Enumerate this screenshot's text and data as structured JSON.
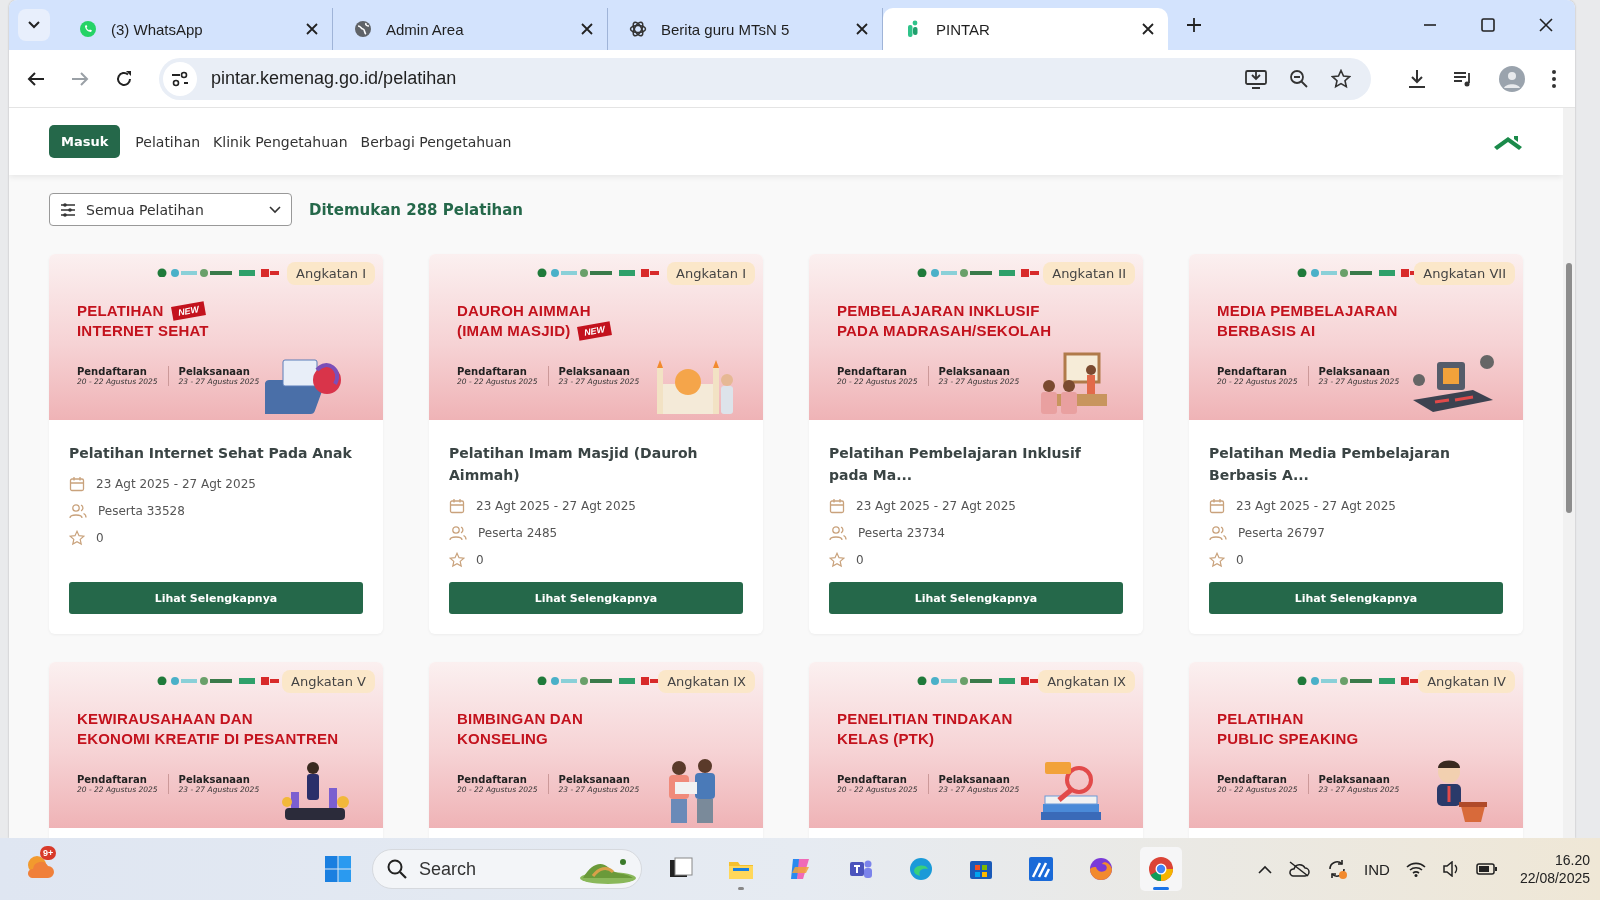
{
  "browser": {
    "tabs": [
      {
        "kind": "chat",
        "title": "(3) WhatsApp",
        "selected": false
      },
      {
        "kind": "globe",
        "title": "Admin Area",
        "selected": false
      },
      {
        "kind": "knot",
        "title": "Berita guru MTsN 5",
        "selected": false
      },
      {
        "kind": "app",
        "title": "PINTAR",
        "selected": true
      }
    ],
    "url": "pintar.kemenag.go.id/pelatihan",
    "forward_disabled": true
  },
  "nav": {
    "login_button": "Masuk",
    "links": [
      "Pelatihan",
      "Klinik Pengetahuan",
      "Berbagi Pengetahuan"
    ]
  },
  "filter": {
    "value": "Semua Pelatihan",
    "result": "Ditemukan 288 Pelatihan"
  },
  "cards": [
    {
      "badge": "Angkatan I",
      "banner": {
        "kind": "laptop",
        "headline": [
          {
            "text": "PELATIHAN",
            "flag": "NEW"
          },
          {
            "text": "INTERNET SEHAT"
          }
        ],
        "registration_label": "Pendaftaran",
        "registration_dates": "20 - 22 Agustus 2025",
        "execution_label": "Pelaksanaan",
        "execution_dates": "23 - 27 Agustus 2025"
      },
      "title": "Pelatihan Internet Sehat Pada Anak",
      "dates": "23 Agt 2025 - 27 Agt 2025",
      "participants": "Peserta 33528",
      "rating": "0",
      "button": "Lihat Selengkapnya"
    },
    {
      "badge": "Angkatan I",
      "banner": {
        "kind": "mosque",
        "headline": [
          {
            "text": "DAUROH AIMMAH"
          },
          {
            "text": "(IMAM MASJID)",
            "flag": "NEW"
          }
        ],
        "registration_label": "Pendaftaran",
        "registration_dates": "20 - 22 Agustus 2025",
        "execution_label": "Pelaksanaan",
        "execution_dates": "23 - 27 Agustus 2025"
      },
      "title": "Pelatihan Imam Masjid (Dauroh Aimmah)",
      "dates": "23 Agt 2025 - 27 Agt 2025",
      "participants": "Peserta 2485",
      "rating": "0",
      "button": "Lihat Selengkapnya"
    },
    {
      "badge": "Angkatan II",
      "banner": {
        "kind": "classroom",
        "headline": [
          {
            "text": "PEMBELAJARAN INKLUSIF"
          },
          {
            "text": "PADA MADRASAH/SEKOLAH"
          }
        ],
        "registration_label": "Pendaftaran",
        "registration_dates": "20 - 22 Agustus 2025",
        "execution_label": "Pelaksanaan",
        "execution_dates": "23 - 27 Agustus 2025"
      },
      "title": "Pelatihan Pembelajaran Inklusif pada Ma...",
      "dates": "23 Agt 2025 - 27 Agt 2025",
      "participants": "Peserta 23734",
      "rating": "0",
      "button": "Lihat Selengkapnya"
    },
    {
      "badge": "Angkatan VII",
      "banner": {
        "kind": "chip",
        "headline": [
          {
            "text": "MEDIA PEMBELAJARAN"
          },
          {
            "text": "BERBASIS AI"
          }
        ],
        "registration_label": "Pendaftaran",
        "registration_dates": "20 - 22 Agustus 2025",
        "execution_label": "Pelaksanaan",
        "execution_dates": "23 - 27 Agustus 2025"
      },
      "title": "Pelatihan Media Pembelajaran Berbasis A...",
      "dates": "23 Agt 2025 - 27 Agt 2025",
      "participants": "Peserta 26797",
      "rating": "0",
      "button": "Lihat Selengkapnya"
    },
    {
      "badge": "Angkatan V",
      "banner": {
        "kind": "trophy",
        "headline": [
          {
            "text": "KEWIRAUSAHAAN DAN"
          },
          {
            "text": "EKONOMI KREATIF DI PESANTREN"
          }
        ],
        "registration_label": "Pendaftaran",
        "registration_dates": "20 - 22 Agustus 2025",
        "execution_label": "Pelaksanaan",
        "execution_dates": "23 - 27 Agustus 2025"
      }
    },
    {
      "badge": "Angkatan IX",
      "banner": {
        "kind": "students",
        "headline": [
          {
            "text": "BIMBINGAN DAN"
          },
          {
            "text": "KONSELING"
          }
        ],
        "registration_label": "Pendaftaran",
        "registration_dates": "20 - 22 Agustus 2025",
        "execution_label": "Pelaksanaan",
        "execution_dates": "23 - 27 Agustus 2025"
      }
    },
    {
      "badge": "Angkatan IX",
      "banner": {
        "kind": "books",
        "headline": [
          {
            "text": "PENELITIAN TINDAKAN"
          },
          {
            "text": "KELAS (PTK)"
          }
        ],
        "registration_label": "Pendaftaran",
        "registration_dates": "20 - 22 Agustus 2025",
        "execution_label": "Pelaksanaan",
        "execution_dates": "23 - 27 Agustus 2025"
      }
    },
    {
      "badge": "Angkatan IV",
      "banner": {
        "kind": "speaker",
        "headline": [
          {
            "text": "PELATIHAN"
          },
          {
            "text": "PUBLIC SPEAKING"
          }
        ],
        "registration_label": "Pendaftaran",
        "registration_dates": "20 - 22 Agustus 2025",
        "execution_label": "Pelaksanaan",
        "execution_dates": "23 - 27 Agustus 2025"
      }
    }
  ],
  "taskbar": {
    "weather_badge": "9+",
    "search": {
      "placeholder": "Search"
    },
    "apps": [
      {
        "kind": "taskview",
        "selected": false,
        "running": false
      },
      {
        "kind": "folder",
        "selected": false,
        "running": true
      },
      {
        "kind": "copilot",
        "selected": false,
        "running": false
      },
      {
        "kind": "teams",
        "selected": false,
        "running": false
      },
      {
        "kind": "edge",
        "selected": false,
        "running": false
      },
      {
        "kind": "store",
        "selected": false,
        "running": false
      },
      {
        "kind": "chart",
        "selected": false,
        "running": false
      },
      {
        "kind": "fox",
        "selected": false,
        "running": false
      },
      {
        "kind": "chrome",
        "selected": true,
        "running": true
      }
    ],
    "language": "IND",
    "time": "16.20",
    "date": "22/08/2025"
  }
}
